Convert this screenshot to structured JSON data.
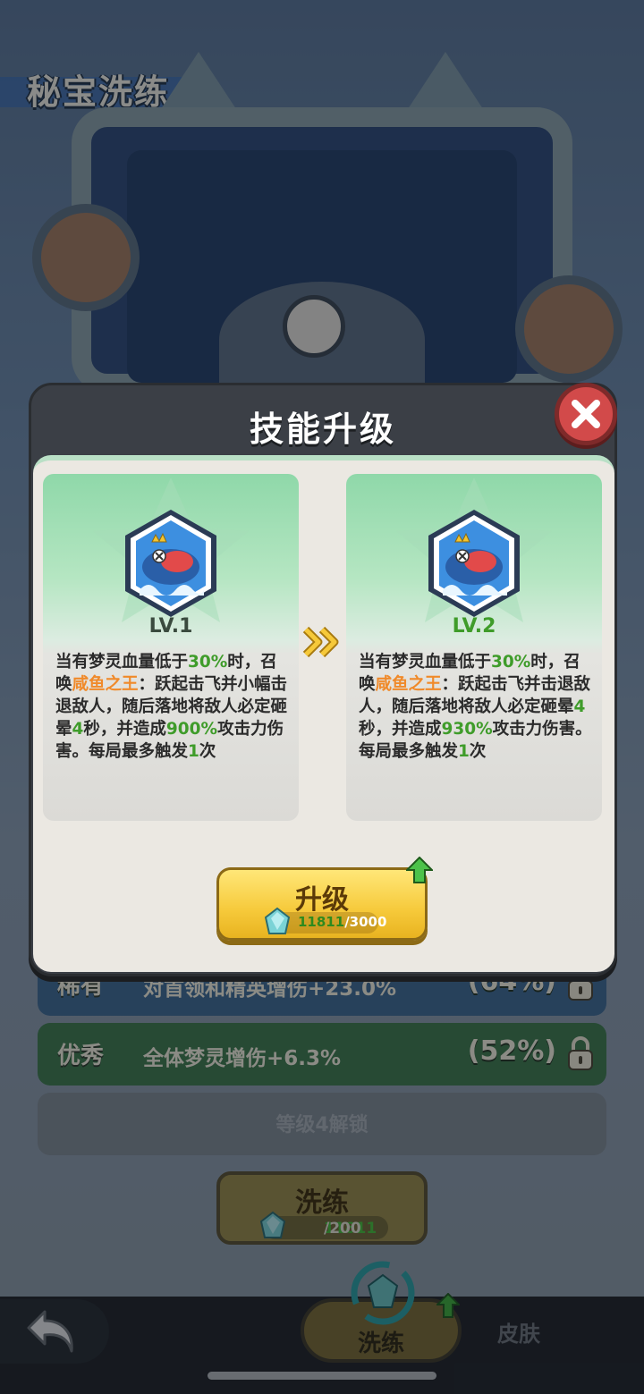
{
  "background": {
    "title": "秘宝洗练",
    "rows": [
      {
        "label": "稀有",
        "desc": "对首领和精英增伤+23.0%",
        "pct": "(64%)"
      },
      {
        "label": "优秀",
        "desc": "全体梦灵增伤+6.3%",
        "pct": "(52%)"
      }
    ],
    "locked_row": "等级4解锁",
    "refine_button": {
      "label": "洗练",
      "have": "11811",
      "need": "/200"
    },
    "tabs": {
      "refine": "洗练",
      "skin": "皮肤"
    }
  },
  "modal": {
    "title": "技能升级",
    "current": {
      "level": "LV.1",
      "desc": {
        "p1": "当有梦灵血量低于",
        "v1": "30%",
        "p2": "时，召唤",
        "name": "咸鱼之王",
        "p3": "：跃起击飞并小幅击退敌人，随后落地将敌人必定砸晕",
        "v2": "4",
        "p4": "秒，并造成",
        "v3": "900%",
        "p5": "攻击力伤害。每局最多触发",
        "v4": "1",
        "p6": "次"
      }
    },
    "next": {
      "level": "LV.2",
      "desc": {
        "p1": "当有梦灵血量低于",
        "v1": "30%",
        "p2": "时，召唤",
        "name": "咸鱼之王",
        "p3": "：跃起击飞并击退敌人，随后落地将敌人必定砸晕",
        "v2": "4",
        "p4": "秒，并造成",
        "v3": "930%",
        "p5": "攻击力伤害。每局最多触发",
        "v4": "1",
        "p6": "次"
      }
    },
    "upgrade_button": {
      "label": "升级",
      "have": "11811",
      "need": "/3000"
    }
  },
  "colors": {
    "highlight_green": "#3f9c2a",
    "highlight_orange": "#f08a2a",
    "button_gold": "#f6c93a",
    "close_red": "#d24a4a"
  },
  "icons": [
    "close-icon",
    "double-chevron-right-icon",
    "gem-icon",
    "up-arrow-icon",
    "back-arrow-icon",
    "lock-icon",
    "salted-fish-king-skill-icon"
  ]
}
